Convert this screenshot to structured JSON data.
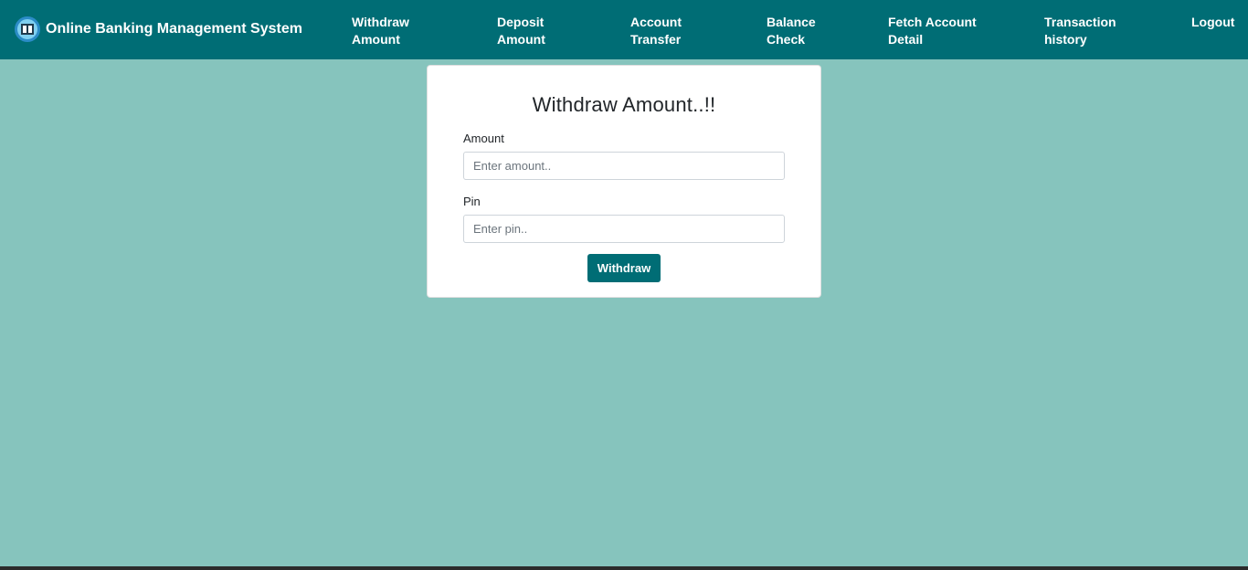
{
  "brand": {
    "title": "Online Banking Management System",
    "logo_icon": "bank-icon"
  },
  "nav": {
    "items": [
      {
        "line1": "Withdraw",
        "line2": "Amount"
      },
      {
        "line1": "Deposit",
        "line2": "Amount"
      },
      {
        "line1": "Account",
        "line2": "Transfer"
      },
      {
        "line1": "Balance",
        "line2": "Check"
      },
      {
        "line1": "Fetch Account",
        "line2": "Detail"
      },
      {
        "line1": "Transaction",
        "line2": "history"
      },
      {
        "line1": "Logout",
        "line2": ""
      }
    ]
  },
  "form": {
    "title": "Withdraw Amount..!!",
    "amount_label": "Amount",
    "amount_placeholder": "Enter amount..",
    "amount_value": "",
    "pin_label": "Pin",
    "pin_placeholder": "Enter pin..",
    "pin_value": "",
    "submit_label": "Withdraw"
  },
  "colors": {
    "navbar": "#006d75",
    "background": "#86c4bd",
    "button": "#006d75",
    "card": "#ffffff"
  }
}
